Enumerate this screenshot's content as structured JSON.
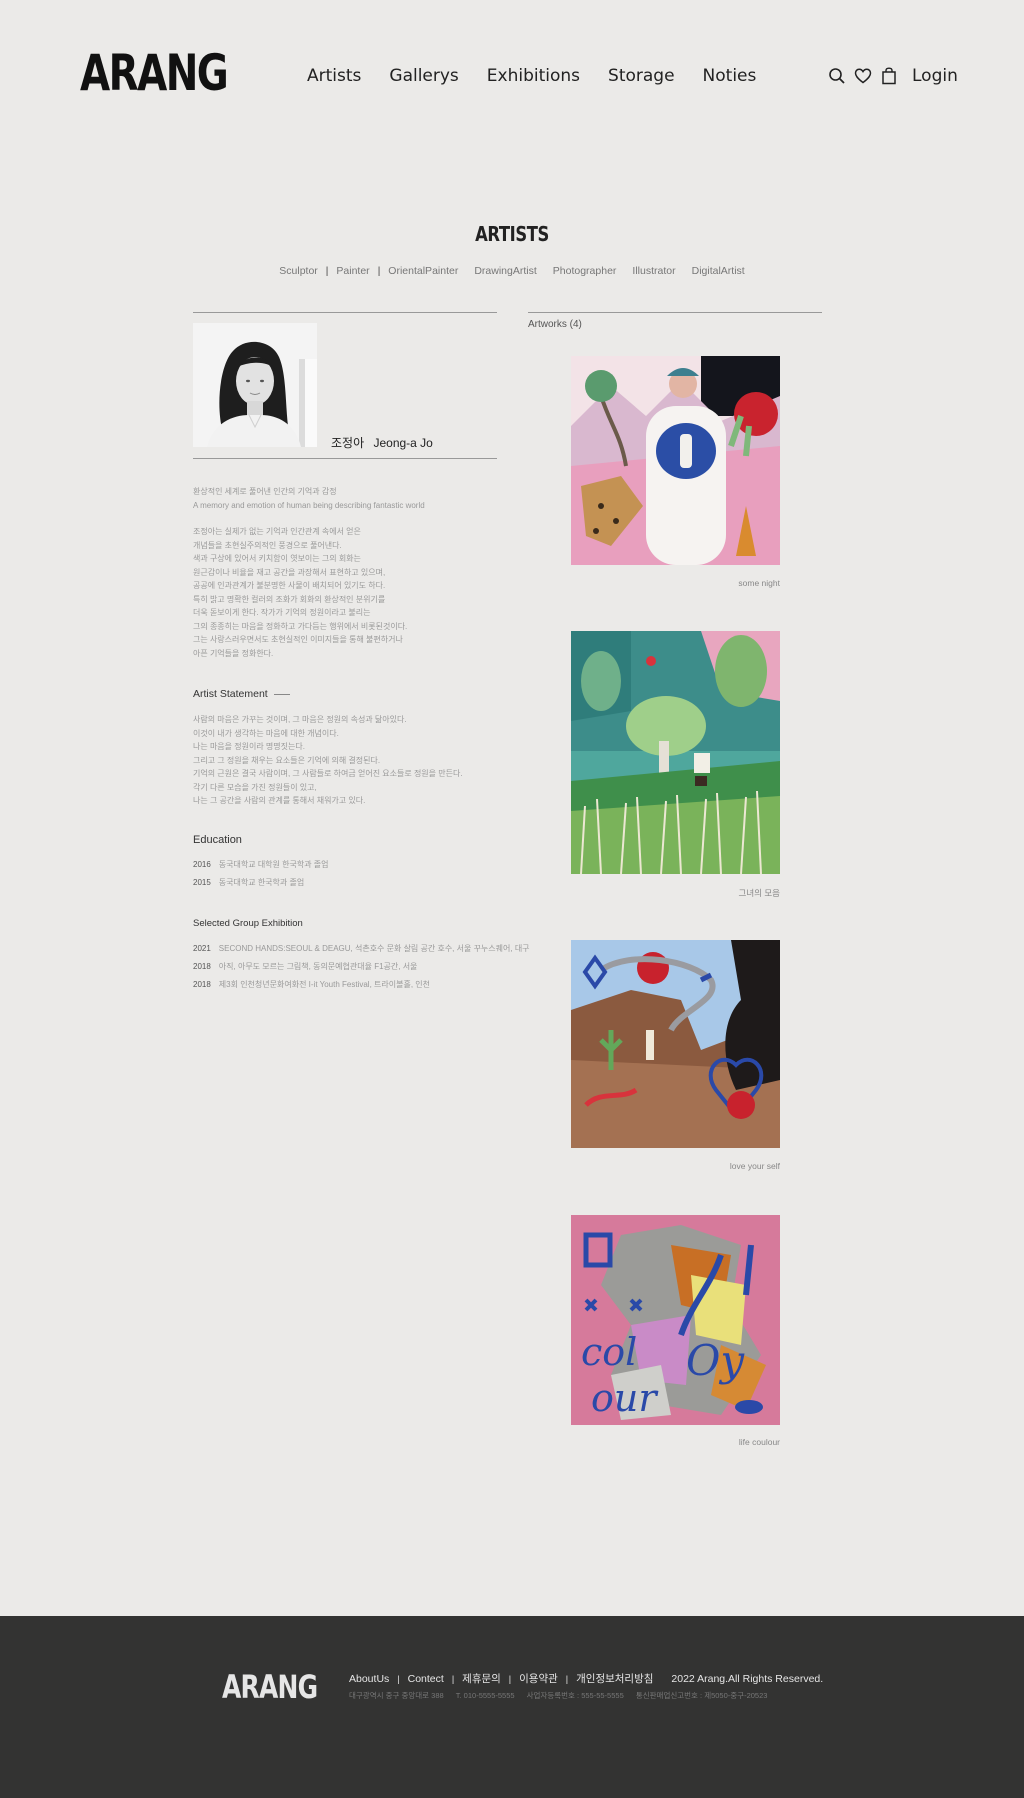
{
  "brand": {
    "logo": "ARANG"
  },
  "nav": [
    "Artists",
    "Gallerys",
    "Exhibitions",
    "Storage",
    "Noties"
  ],
  "header": {
    "login": "Login"
  },
  "page": {
    "title": "ARTISTS"
  },
  "filters": [
    "Sculptor",
    "Painter",
    "OrientalPainter",
    "DrawingArtist",
    "Photographer",
    "Illustrator",
    "DigitalArtist"
  ],
  "artist": {
    "name_ko": "조정아",
    "name_en": "Jeong-a Jo",
    "tagline_ko": "환상적인 세계로 풀어낸 인간의 기억과 감정",
    "tagline_en": "A memory and emotion of human being describing fantastic world",
    "bio": [
      "조정아는 실제가 없는 기억과 인간관계 속에서 얻은",
      "개념들을 초현실주의적인 풍경으로 풀어낸다.",
      "색과 구상에 있어서 키치함이 엿보이는 그의 회화는",
      "원근감이나 비율을 재고 공간을 과장해서 표현하고 있으며,",
      "공공에 인과관계가 불분명한 사물이 배치되어 있기도 하다.",
      "특히 밝고 명확한 컬러의 조화가 회화의 환상적인 분위기를",
      "더욱 돋보이게 한다. 작가가 기억의 정원이라고 불리는",
      "그의 종종히는 마음을 정화하고 가다듬는 행위에서 비롯된것이다.",
      "그는 사랑스러우면서도 초현실적인 이미지들을 통해 불편하거나",
      "아픈 기억들을 정화한다."
    ],
    "statement_title": "Artist Statement",
    "statement": [
      "사람의 마음은 가꾸는 것이며, 그 마음은 정원의 속성과 닮아있다.",
      "이것이 내가 생각하는 마음에 대한 개념이다.",
      "나는 마음을 정원이라 명명짓는다.",
      "그리고 그 정원을 채우는 요소들은 기억에 의해 결정된다.",
      "기억의 근원은 결국 사람이며, 그 사람들로 하여금 얻어진 요소들로 정원을 만든다.",
      "각기 다른 모습을 가진 정원들이 있고,",
      "나는 그 공간을 사람의 관계를 통해서 채워가고 있다."
    ],
    "education_title": "Education",
    "education": [
      {
        "year": "2016",
        "text": "동국대학교 대학원 한국학과 졸업"
      },
      {
        "year": "2015",
        "text": "동국대학교 한국학과 졸업"
      }
    ],
    "exhibition_title": "Selected Group Exhibition",
    "exhibitions": [
      {
        "year": "2021",
        "text": "SECOND HANDS:SEOUL & DEAGU, 석촌호수 문화 살림 공간 호수, 서울 꾸누스퀘어, 대구"
      },
      {
        "year": "2018",
        "text": "아직, 아무도 모르는 그림책, 동의문예협관대율 F1공간, 서울"
      },
      {
        "year": "2018",
        "text": "제3회 인천청년문화여화전 I-it Youth Festival, 트라이볼홀, 인천"
      }
    ]
  },
  "artworks": {
    "label": "Artworks (4)",
    "items": [
      {
        "title": "some night"
      },
      {
        "title": "그녀의 모음"
      },
      {
        "title": "love your self"
      },
      {
        "title": "life coulour"
      }
    ]
  },
  "footer": {
    "logo": "ARANG",
    "links": [
      "AboutUs",
      "Contect",
      "제휴문의",
      "이용약관",
      "개인정보처리방침"
    ],
    "copyright": "2022 Arang.All Rights Reserved.",
    "info": [
      "대구광역시 중구 중앙대로 388",
      "T. 010-5555-5555",
      "사업자등록번호 : 555-55-5555",
      "통신판매업신고번호 : 제5050-중구-20523"
    ]
  },
  "colors": {
    "background": "#ebeae8",
    "footer": "#333332",
    "text": "#222222",
    "muted": "#999999"
  },
  "icons": [
    "search-icon",
    "heart-icon",
    "shopping-bag-icon"
  ]
}
